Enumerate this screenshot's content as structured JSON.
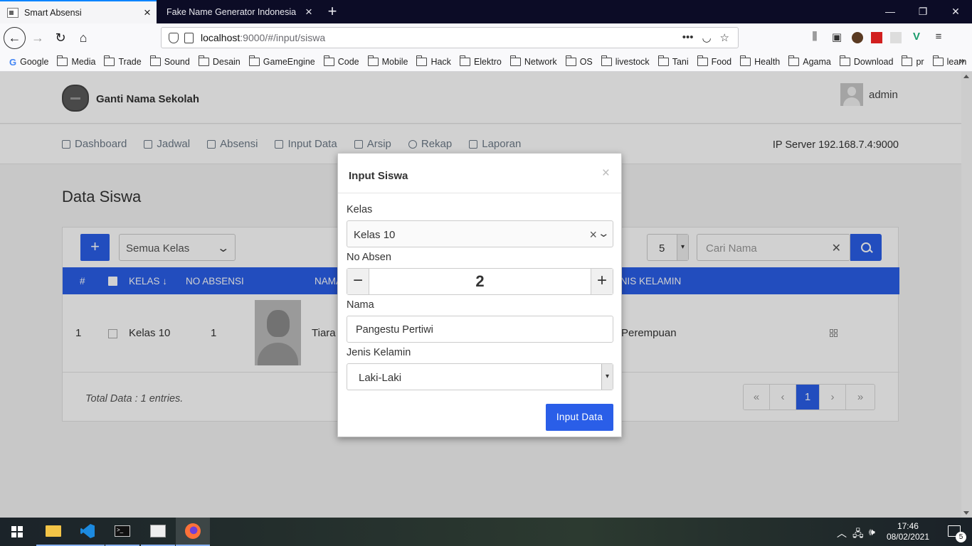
{
  "browser": {
    "tabs": [
      {
        "title": "Smart Absensi",
        "active": true
      },
      {
        "title": "Fake Name Generator Indonesia",
        "active": false
      }
    ],
    "url_host": "localhost",
    "url_path": ":9000/#/input/siswa",
    "bookmarks": [
      "Google",
      "Media",
      "Trade",
      "Sound",
      "Desain",
      "GameEngine",
      "Code",
      "Mobile",
      "Hack",
      "Elektro",
      "Network",
      "OS",
      "livestock",
      "Tani",
      "Food",
      "Health",
      "Agama",
      "Download",
      "pr",
      "learn"
    ]
  },
  "app": {
    "school_name": "Ganti Nama Sekolah",
    "user": "admin",
    "menu": [
      "Dashboard",
      "Jadwal",
      "Absensi",
      "Input Data",
      "Arsip",
      "Rekap",
      "Laporan"
    ],
    "ip_label": "IP Server",
    "ip_value": "192.168.7.4:9000",
    "page_title": "Data Siswa",
    "filter_kelas": "Semua Kelas",
    "page_size": "5",
    "search_placeholder": "Cari Nama",
    "table": {
      "headers": {
        "num": "#",
        "kelas": "KELAS ↓",
        "no_absensi": "NO ABSENSI",
        "nama": "NAMA",
        "jenis_kelamin": "JENIS KELAMIN"
      },
      "rows": [
        {
          "num": "1",
          "kelas": "Kelas 10",
          "no_absen": "1",
          "nama": "Tiara",
          "jenis_kelamin": "Perempuan"
        }
      ]
    },
    "total": "Total Data : 1 entries.",
    "pager": {
      "first": "«",
      "prev": "‹",
      "current": "1",
      "next": "›",
      "last": "»"
    }
  },
  "modal": {
    "title": "Input Siswa",
    "close": "×",
    "kelas_label": "Kelas",
    "kelas_value": "Kelas 10",
    "no_absen_label": "No Absen",
    "no_absen_value": "2",
    "nama_label": "Nama",
    "nama_value": "Pangestu Pertiwi",
    "jk_label": "Jenis Kelamin",
    "jk_value": "Laki-Laki",
    "submit": "Input Data"
  },
  "taskbar": {
    "time": "17:46",
    "date": "08/02/2021",
    "notifications": "5"
  },
  "colors": {
    "primary": "#2a5ee8",
    "titlebar": "#0c0c26"
  }
}
